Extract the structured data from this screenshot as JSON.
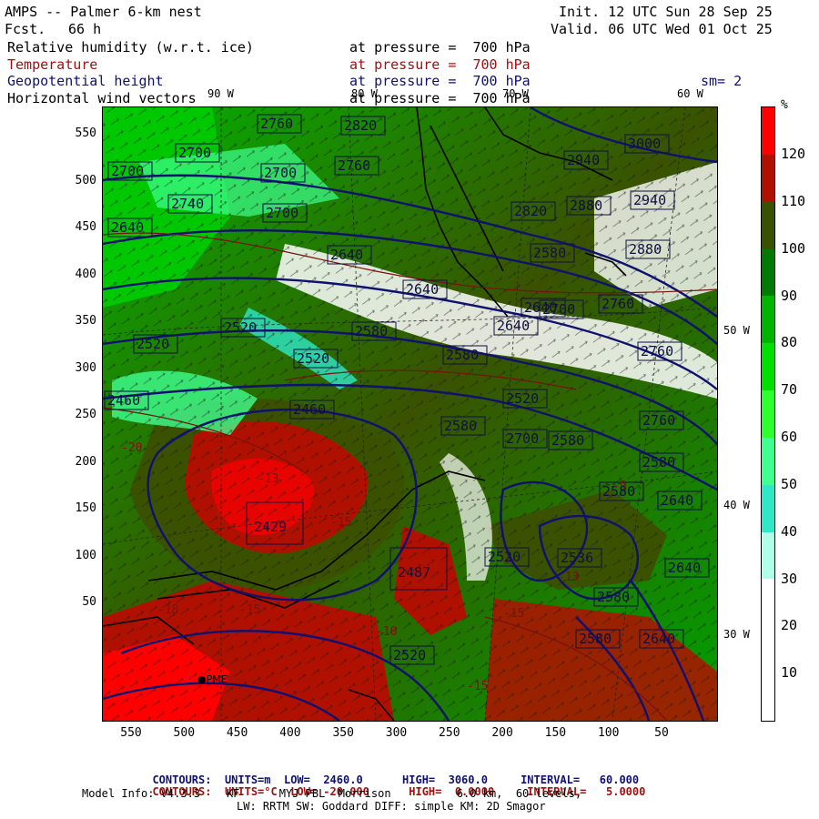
{
  "header": {
    "model": "AMPS -- Palmer 6-km nest",
    "fcst_label": "Fcst.",
    "fcst_value": "66 h",
    "init": "Init. 12 UTC Sun 28 Sep 25",
    "valid": "Valid. 06 UTC Wed 01 Oct 25",
    "fields": [
      {
        "name": "Relative humidity (w.r.t. ice)",
        "level": "at pressure =  700 hPa",
        "color": "#000000"
      },
      {
        "name": "Temperature",
        "level": "at pressure =  700 hPa",
        "color": "#a01010"
      },
      {
        "name": "Geopotential height",
        "level": "at pressure =  700 hPa",
        "color": "#101070"
      },
      {
        "name": "Horizontal wind vectors",
        "level": "at pressure =  700 hPa",
        "color": "#000000"
      }
    ],
    "smoothing": "sm= 2"
  },
  "meridian_labels": {
    "top": [
      "90 W",
      "80 W",
      "70 W",
      "60 W"
    ],
    "right": [
      "50 W",
      "40 W",
      "30 W"
    ]
  },
  "axes": {
    "y_ticks": [
      "550",
      "500",
      "450",
      "400",
      "350",
      "300",
      "250",
      "200",
      "150",
      "100",
      "50"
    ],
    "x_ticks": [
      "550",
      "500",
      "450",
      "400",
      "350",
      "300",
      "250",
      "200",
      "150",
      "100",
      "50"
    ]
  },
  "map": {
    "height_contours": [
      "2460",
      "2520",
      "2580",
      "2640",
      "2700",
      "2760",
      "2820",
      "2880",
      "2940",
      "3000"
    ],
    "height_labels": [
      "2760",
      "2820",
      "2700",
      "2700",
      "2760",
      "2700",
      "3000",
      "2940",
      "2640",
      "2740",
      "2700",
      "2820",
      "2880",
      "2940",
      "2640",
      "2640",
      "2580",
      "2640",
      "2880",
      "2760",
      "2700",
      "2760",
      "2520",
      "2580",
      "2640",
      "2520",
      "2520",
      "2580",
      "2760",
      "2580",
      "2460",
      "2460",
      "2520",
      "2580",
      "2580",
      "2700",
      "2580",
      "2640",
      "2520",
      "2536",
      "2640",
      "2580",
      "2580",
      "2640",
      "2520"
    ],
    "low_centers": [
      "2429",
      "2487"
    ],
    "temp_labels": [
      "-20",
      "-13",
      "-15",
      "-18",
      "-15",
      "-10",
      "-15",
      "-13",
      "-15",
      "-9"
    ],
    "place_marker": "PME"
  },
  "colorbar": {
    "unit": "%",
    "labels": [
      "120",
      "110",
      "100",
      "90",
      "80",
      "70",
      "60",
      "50",
      "40",
      "30",
      "20",
      "10"
    ],
    "colors": [
      "#ff0000",
      "#b01000",
      "#3a5200",
      "#007a00",
      "#00b400",
      "#00e000",
      "#30ff30",
      "#40ff90",
      "#30e8c8",
      "#b0ffe8",
      "#ffffff",
      "#ffffff",
      "#ffffff"
    ]
  },
  "footer": {
    "line1": {
      "label": "CONTOURS:",
      "units": "UNITS=m",
      "low": "LOW=  2460.0",
      "high": "HIGH=  3060.0",
      "interval": "INTERVAL=   60.000",
      "color": "#101070"
    },
    "line2": {
      "label": "CONTOURS:",
      "units": "UNITS=°C",
      "low": "LOW= -20.000",
      "high": "HIGH=  0.0000",
      "interval": "INTERVAL=   5.0000",
      "color": "#a01010"
    },
    "line3": "Model Info: V4.3.3    KF      MYJ PBL  Morrison          6.0 km,  60 levels,",
    "line4": "LW: RRTM SW: Goddard DIFF: simple KM: 2D Smagor"
  }
}
